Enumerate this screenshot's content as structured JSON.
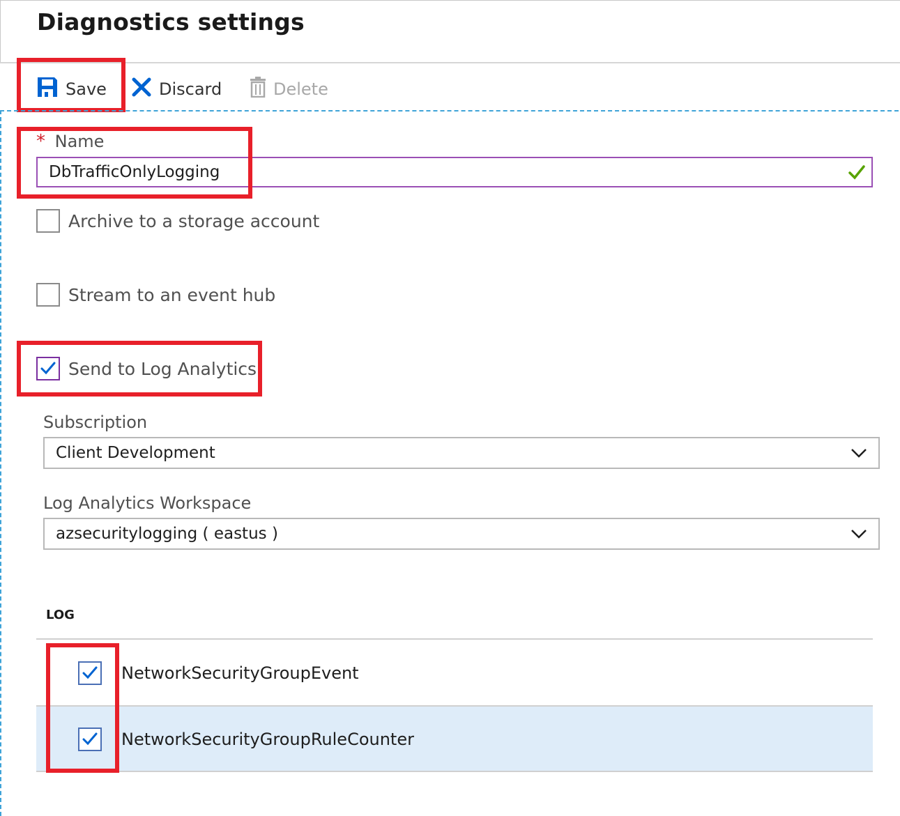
{
  "page": {
    "title": "Diagnostics settings"
  },
  "toolbar": {
    "save_label": "Save",
    "discard_label": "Discard",
    "delete_label": "Delete"
  },
  "form": {
    "name_required_mark": "*",
    "name_label": "Name",
    "name_value": "DbTrafficOnlyLogging",
    "archive_label": "Archive to a storage account",
    "archive_checked": false,
    "stream_label": "Stream to an event hub",
    "stream_checked": false,
    "log_analytics_label": "Send to Log Analytics",
    "log_analytics_checked": true,
    "subscription_label": "Subscription",
    "subscription_value": "Client Development",
    "workspace_label": "Log Analytics Workspace",
    "workspace_value": "azsecuritylogging ( eastus )"
  },
  "logs": {
    "header": "LOG",
    "rows": [
      {
        "name": "NetworkSecurityGroupEvent",
        "checked": true,
        "selected": false
      },
      {
        "name": "NetworkSecurityGroupRuleCounter",
        "checked": true,
        "selected": true
      }
    ]
  },
  "colors": {
    "accent": "#0063d1",
    "highlight_box": "#e8202a",
    "input_focus": "#9a4fb5",
    "valid_check": "#57a300",
    "selected_row": "#deecf9"
  }
}
